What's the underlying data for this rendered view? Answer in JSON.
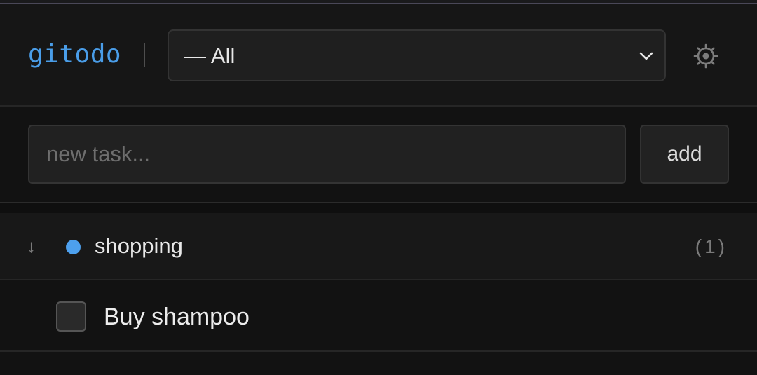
{
  "app": {
    "brand": "gitodo"
  },
  "header": {
    "filter_value": "— All"
  },
  "composer": {
    "input_placeholder": "new task...",
    "input_value": "",
    "add_label": "add"
  },
  "groups": [
    {
      "sort_glyph": "↓",
      "name": "shopping",
      "count": "(1)",
      "dot_color": "#4da0ee",
      "tasks": [
        {
          "label": "Buy shampoo",
          "checked": false
        }
      ]
    }
  ],
  "colors": {
    "brand": "#4a9de8",
    "accent_dot": "#4da0ee",
    "background": "#121212"
  },
  "icons": {
    "filter_chevron": "chevron-down-icon",
    "settings": "gear-icon",
    "sort": "sort-arrow-icon"
  }
}
